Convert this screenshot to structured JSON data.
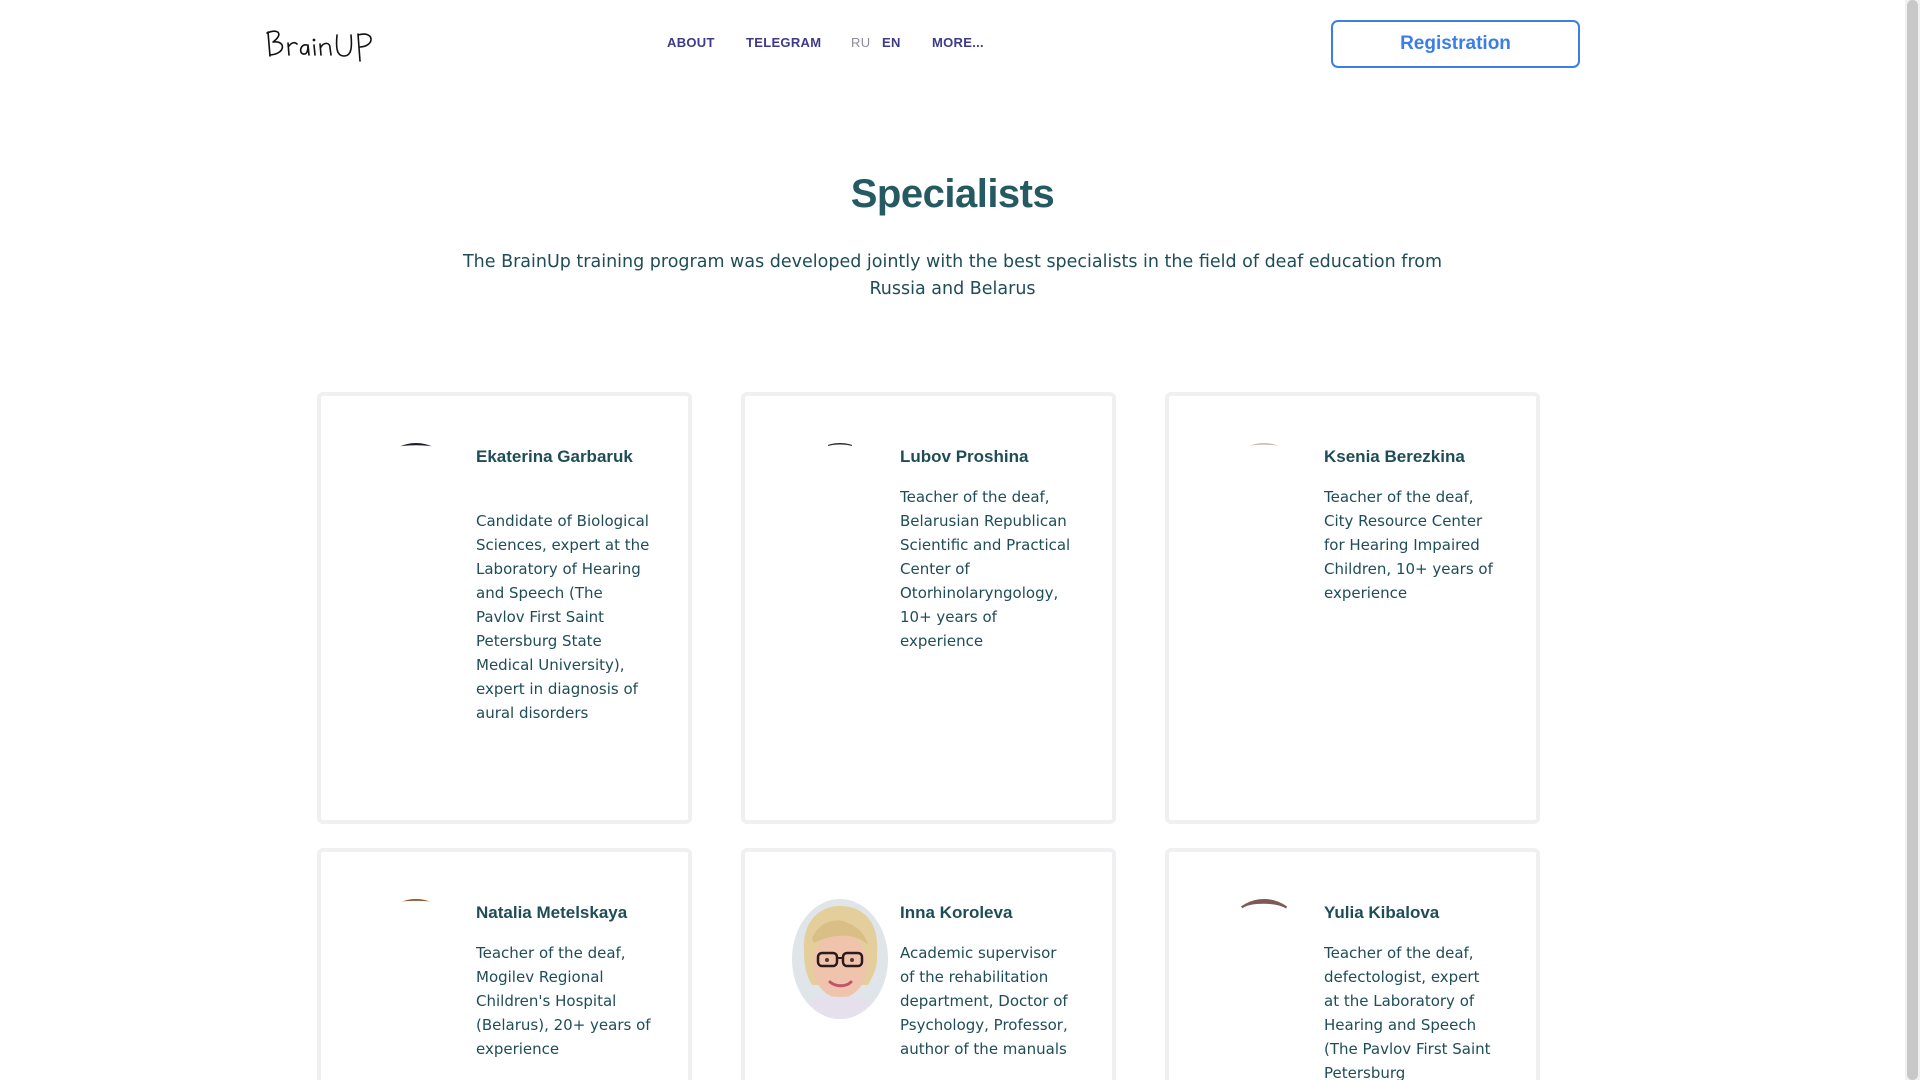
{
  "header": {
    "logo_text": "BrainUP",
    "nav": {
      "about": "ABOUT",
      "telegram": "TELEGRAM",
      "ru": "RU",
      "en": "EN",
      "more": "MORE..."
    },
    "registration_label": "Registration"
  },
  "main": {
    "title": "Specialists",
    "subtitle": "The BrainUp training program was developed jointly with the best specialists in the field of deaf education from Russia and Belarus"
  },
  "specialists": [
    {
      "name": "Ekaterina Garbaruk",
      "description": "Candidate of Biological Sciences, expert at the Laboratory of Hearing and Speech (The Pavlov First Saint Petersburg State Medical University), expert in diagnosis of aural disorders"
    },
    {
      "name": "Lubov Proshina",
      "description": "Teacher of the deaf, Belarusian Republican Scientific and Practical Center of Otorhinolaryngology, 10+ years of experience"
    },
    {
      "name": "Ksenia Berezkina",
      "description": "Teacher of the deaf, City Resource Center for Hearing Impaired Children, 10+ years of experience"
    },
    {
      "name": "Natalia Metelskaya",
      "description": "Teacher of the deaf, Mogilev Regional Children's Hospital (Belarus), 20+ years of experience"
    },
    {
      "name": "Inna Koroleva",
      "description": "Academic supervisor of the rehabilitation department, Doctor of Psychology, Professor, author of the manuals"
    },
    {
      "name": "Yulia Kibalova",
      "description": "Teacher of the deaf, defectologist, expert at the Laboratory of Hearing and Speech (The Pavlov First Saint Petersburg"
    }
  ],
  "colors": {
    "accent_blue": "#3b7ee8",
    "nav_text": "#3d3a8c",
    "heading_teal": "#265a63",
    "card_border": "#f0f0f3"
  }
}
